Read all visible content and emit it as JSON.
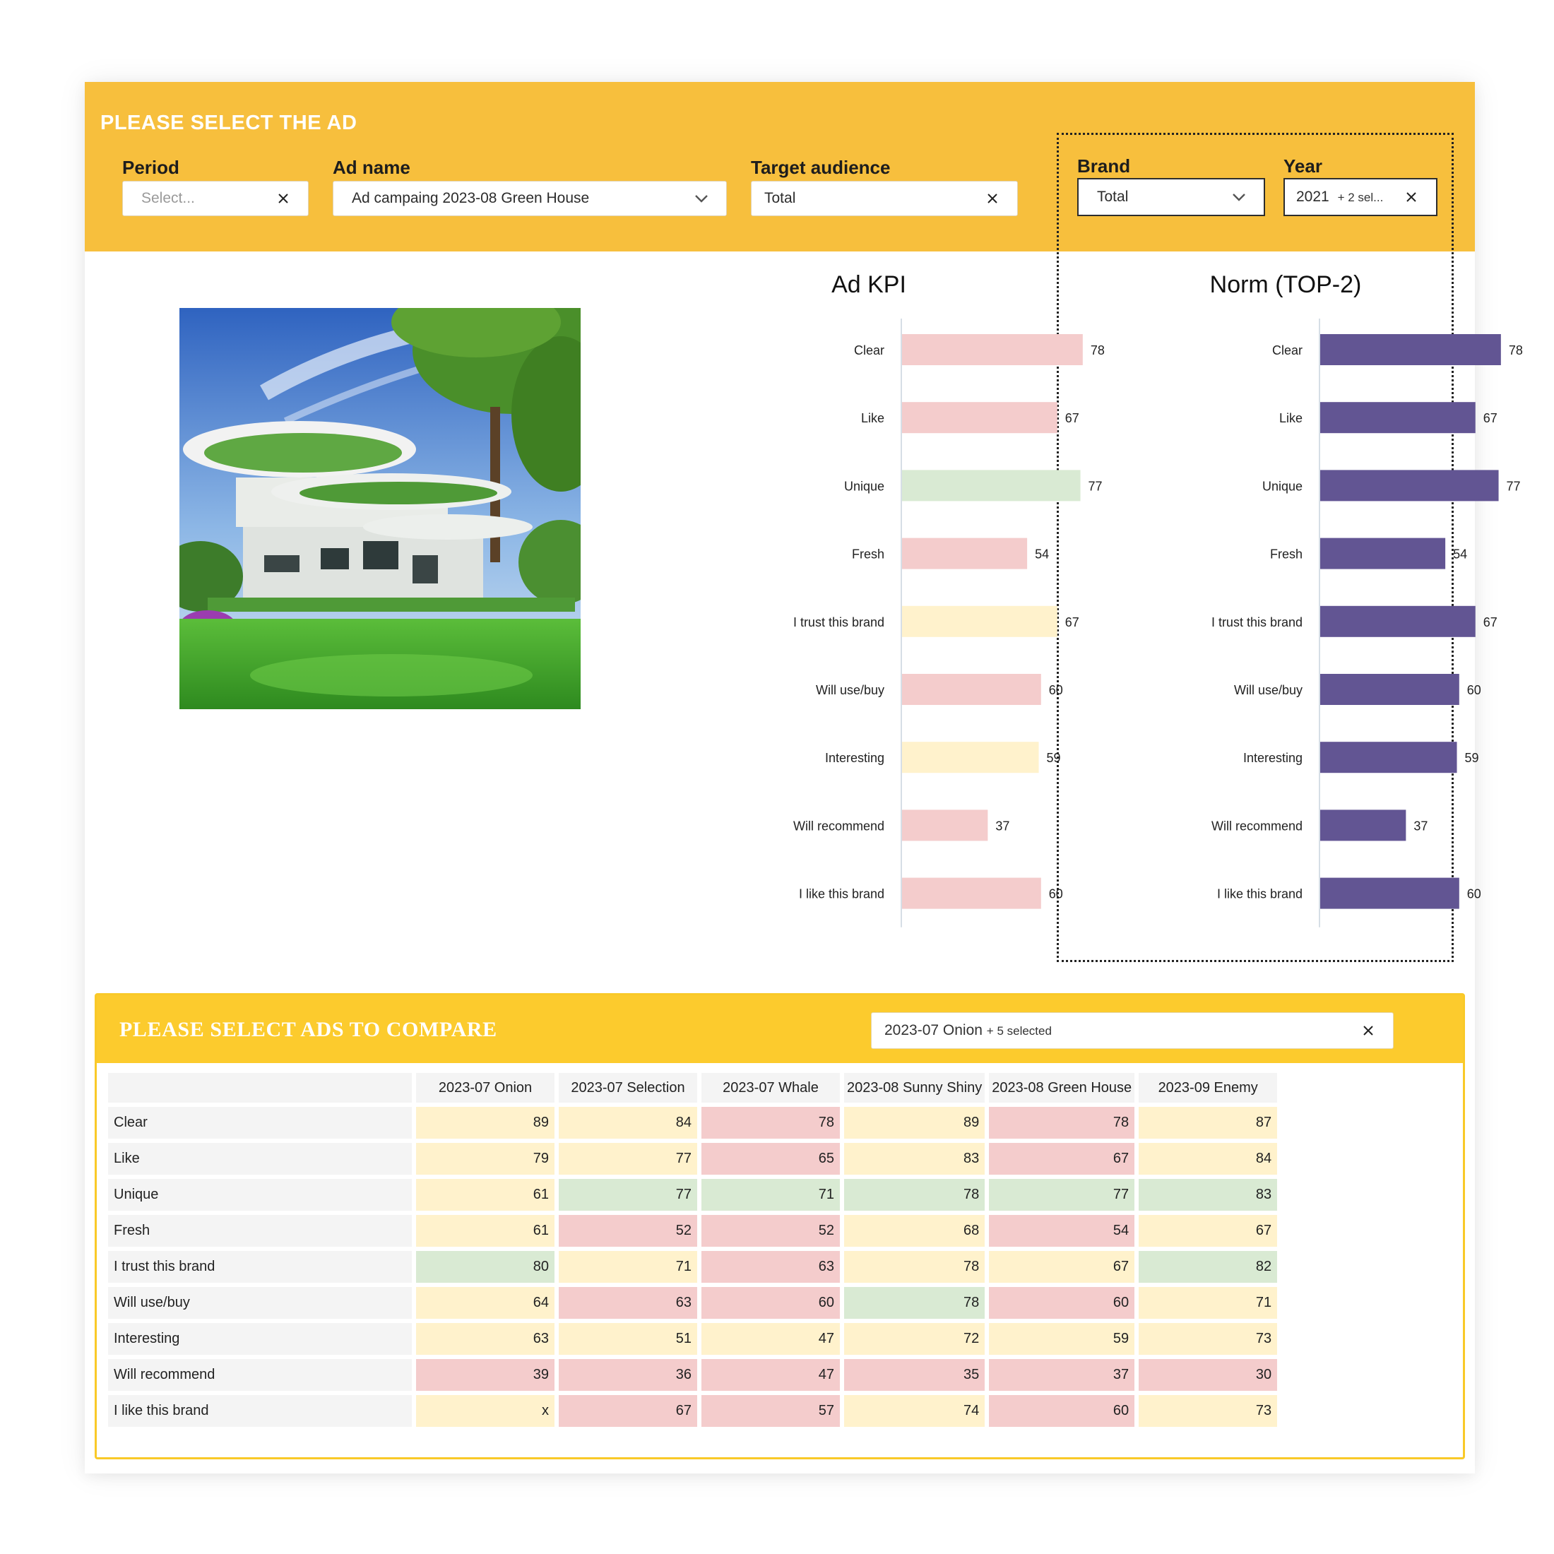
{
  "colors": {
    "band": "#f7bf3d",
    "compare_band": "#fccb2d",
    "kpi_red": "#f4cccc",
    "kpi_green": "#d9ead3",
    "kpi_yellow": "#fff2cc",
    "norm_purple": "#625593"
  },
  "filters": {
    "title": "PLEASE SELECT THE AD",
    "period": {
      "label": "Period",
      "placeholder": "Select..."
    },
    "ad_name": {
      "label": "Ad name",
      "value": "Ad campaing 2023-08 Green House"
    },
    "target": {
      "label": "Target audience",
      "value": "Total"
    },
    "brand": {
      "label": "Brand",
      "value": "Total"
    },
    "year": {
      "label": "Year",
      "value": "2021",
      "extra": "+ 2 sel..."
    }
  },
  "chart_data": [
    {
      "type": "bar",
      "orientation": "horizontal",
      "title": "Ad KPI",
      "categories": [
        "Clear",
        "Like",
        "Unique",
        "Fresh",
        "I trust this brand",
        "Will use/buy",
        "Interesting",
        "Will recommend",
        "I like this brand"
      ],
      "values": [
        78,
        67,
        77,
        54,
        67,
        60,
        59,
        37,
        60
      ],
      "bar_colors": [
        "red",
        "red",
        "green",
        "red",
        "yellow",
        "red",
        "yellow",
        "red",
        "red"
      ],
      "xlim": [
        0,
        100
      ]
    },
    {
      "type": "bar",
      "orientation": "horizontal",
      "title": "Norm (TOP-2)",
      "categories": [
        "Clear",
        "Like",
        "Unique",
        "Fresh",
        "I trust this brand",
        "Will use/buy",
        "Interesting",
        "Will recommend",
        "I like this brand"
      ],
      "values": [
        78,
        67,
        77,
        54,
        67,
        60,
        59,
        37,
        60
      ],
      "bar_colors": [
        "purple",
        "purple",
        "purple",
        "purple",
        "purple",
        "purple",
        "purple",
        "purple",
        "purple"
      ],
      "xlim": [
        0,
        100
      ]
    }
  ],
  "compare": {
    "title": "PLEASE SELECT ADS TO COMPARE",
    "select": {
      "value": "2023-07 Onion",
      "extra": "+ 5 selected"
    },
    "columns": [
      "2023-07 Onion",
      "2023-07 Selection",
      "2023-07 Whale",
      "2023-08 Sunny Shiny",
      "2023-08 Green House",
      "2023-09 Enemy"
    ],
    "rows": [
      {
        "label": "Clear",
        "values": [
          "89",
          "84",
          "78",
          "89",
          "78",
          "87"
        ],
        "colors": [
          "yellow",
          "yellow",
          "red",
          "yellow",
          "red",
          "yellow"
        ]
      },
      {
        "label": "Like",
        "values": [
          "79",
          "77",
          "65",
          "83",
          "67",
          "84"
        ],
        "colors": [
          "yellow",
          "yellow",
          "red",
          "yellow",
          "red",
          "yellow"
        ]
      },
      {
        "label": "Unique",
        "values": [
          "61",
          "77",
          "71",
          "78",
          "77",
          "83"
        ],
        "colors": [
          "yellow",
          "green",
          "green",
          "green",
          "green",
          "green"
        ]
      },
      {
        "label": "Fresh",
        "values": [
          "61",
          "52",
          "52",
          "68",
          "54",
          "67"
        ],
        "colors": [
          "yellow",
          "red",
          "red",
          "yellow",
          "red",
          "yellow"
        ]
      },
      {
        "label": "I trust this brand",
        "values": [
          "80",
          "71",
          "63",
          "78",
          "67",
          "82"
        ],
        "colors": [
          "green",
          "yellow",
          "red",
          "yellow",
          "yellow",
          "green"
        ]
      },
      {
        "label": "Will use/buy",
        "values": [
          "64",
          "63",
          "60",
          "78",
          "60",
          "71"
        ],
        "colors": [
          "yellow",
          "red",
          "red",
          "green",
          "red",
          "yellow"
        ]
      },
      {
        "label": "Interesting",
        "values": [
          "63",
          "51",
          "47",
          "72",
          "59",
          "73"
        ],
        "colors": [
          "yellow",
          "yellow",
          "yellow",
          "yellow",
          "yellow",
          "yellow"
        ]
      },
      {
        "label": "Will recommend",
        "values": [
          "39",
          "36",
          "47",
          "35",
          "37",
          "30"
        ],
        "colors": [
          "red",
          "red",
          "red",
          "red",
          "red",
          "red"
        ]
      },
      {
        "label": "I like this brand",
        "values": [
          "x",
          "67",
          "57",
          "74",
          "60",
          "73"
        ],
        "colors": [
          "yellow",
          "red",
          "red",
          "yellow",
          "red",
          "yellow"
        ]
      }
    ]
  }
}
